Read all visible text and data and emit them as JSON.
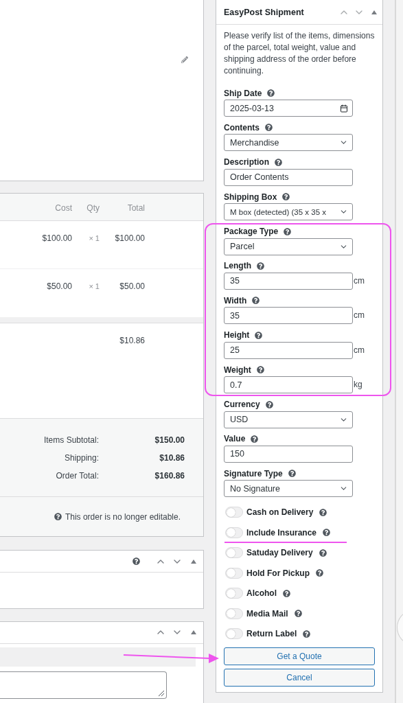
{
  "order_items": {
    "columns": [
      "Cost",
      "Qty",
      "Total"
    ],
    "rows": [
      {
        "cost": "$100.00",
        "qty": "× 1",
        "total": "$100.00"
      },
      {
        "cost": "$50.00",
        "qty": "× 1",
        "total": "$50.00"
      }
    ],
    "shipping_total": "$10.86",
    "totals": [
      {
        "label": "Items Subtotal:",
        "value": "$150.00"
      },
      {
        "label": "Shipping:",
        "value": "$10.86"
      },
      {
        "label": "Order Total:",
        "value": "$160.86"
      }
    ],
    "note": "This order is no longer editable."
  },
  "shipment_panel": {
    "title": "EasyPost Shipment",
    "intro": "Please verify list of the items, dimensions of the parcel, total weight, value and shipping address of the order before continuing.",
    "fields": [
      {
        "label": "Ship Date",
        "kind": "date",
        "value": "2025-03-13"
      },
      {
        "label": "Contents",
        "kind": "select",
        "value": "Merchandise"
      },
      {
        "label": "Description",
        "kind": "text",
        "value": "Order Contents"
      },
      {
        "label": "Shipping Box",
        "kind": "select",
        "value": "M box (detected) (35 x 35 x"
      },
      {
        "label": "Package Type",
        "kind": "select",
        "value": "Parcel"
      },
      {
        "label": "Length",
        "kind": "text",
        "value": "35",
        "unit": "cm"
      },
      {
        "label": "Width",
        "kind": "text",
        "value": "35",
        "unit": "cm"
      },
      {
        "label": "Height",
        "kind": "text",
        "value": "25",
        "unit": "cm"
      },
      {
        "label": "Weight",
        "kind": "text",
        "value": "0.7",
        "unit": "kg"
      },
      {
        "label": "Currency",
        "kind": "select",
        "value": "USD"
      },
      {
        "label": "Value",
        "kind": "text",
        "value": "150"
      },
      {
        "label": "Signature Type",
        "kind": "select",
        "value": "No Signature"
      }
    ],
    "toggles": [
      {
        "label": "Cash on Delivery",
        "on": false
      },
      {
        "label": "Include Insurance",
        "on": false
      },
      {
        "label": "Satuday Delivery",
        "on": false
      },
      {
        "label": "Hold For Pickup",
        "on": false
      },
      {
        "label": "Alcohol",
        "on": false
      },
      {
        "label": "Media Mail",
        "on": false
      },
      {
        "label": "Return Label",
        "on": false
      }
    ],
    "buttons": [
      "Get a Quote",
      "Cancel"
    ]
  }
}
